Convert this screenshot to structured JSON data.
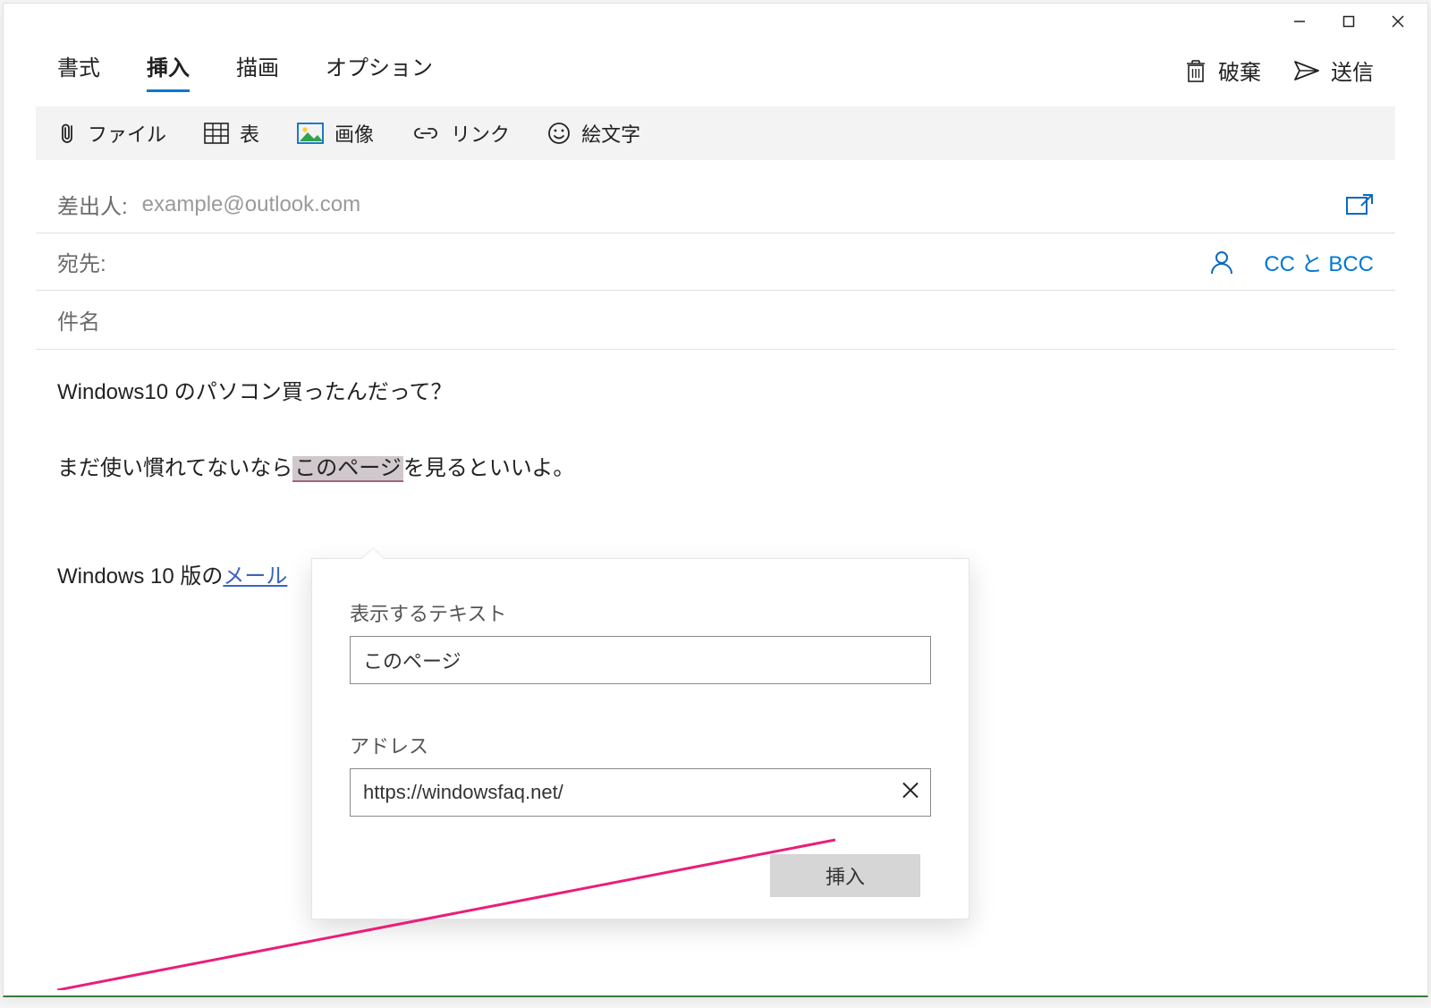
{
  "window": {
    "minimize_label": "最小化",
    "maximize_label": "最大化",
    "close_label": "閉じる"
  },
  "tabs": {
    "format": "書式",
    "insert": "挿入",
    "draw": "描画",
    "options": "オプション",
    "active": "insert"
  },
  "actions": {
    "discard": "破棄",
    "send": "送信"
  },
  "ribbon": {
    "file": "ファイル",
    "table": "表",
    "image": "画像",
    "link": "リンク",
    "emoji": "絵文字"
  },
  "fields": {
    "from_label": "差出人:",
    "from_value": "example@outlook.com",
    "to_label": "宛先:",
    "cc_bcc": "CC と BCC",
    "subject_placeholder": "件名"
  },
  "body": {
    "line1": "Windows10 のパソコン買ったんだって？",
    "line2_prefix": "まだ使い慣れてないなら",
    "line2_highlight": "このページ",
    "line2_suffix": "を見るといいよ。",
    "line3_prefix": "Windows 10 版の",
    "line3_link": "メール"
  },
  "link_dialog": {
    "text_label": "表示するテキスト",
    "text_value": "このページ",
    "address_label": "アドレス",
    "address_value": "https://windowsfaq.net/",
    "insert_button": "挿入"
  }
}
